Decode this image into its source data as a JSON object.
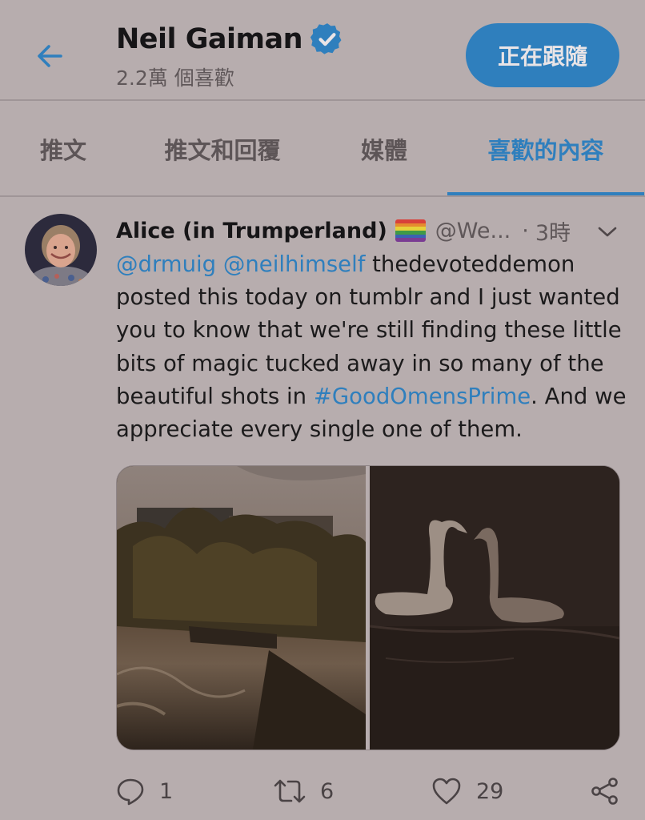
{
  "header": {
    "title": "Neil Gaiman",
    "likes_count": "2.2萬 個喜歡",
    "follow_label": "正在跟隨"
  },
  "tabs": [
    {
      "label": "推文"
    },
    {
      "label": "推文和回覆"
    },
    {
      "label": "媒體"
    },
    {
      "label": "喜歡的內容"
    }
  ],
  "active_tab": "喜歡的內容",
  "tweet": {
    "author": "Alice (in Trumperland)",
    "handle": "@We...",
    "separator": "·",
    "time": "3時",
    "mention1": "@drmuig",
    "mention2": "@neilhimself",
    "text_before_hashtag": " thedevoteddemon posted this today on tumblr and I just wanted you to know that we're still finding these little bits of magic tucked away in so many of the beautiful shots in ",
    "hashtag": "#GoodOmensPrime",
    "text_after_hashtag": ".  And we appreciate every single one of them.",
    "reply_count": "1",
    "retweet_count": "6",
    "like_count": "29"
  },
  "icons": {
    "back": "arrow-left-icon",
    "verified": "verified-badge-icon",
    "caret": "chevron-down-icon",
    "reply": "reply-icon",
    "retweet": "retweet-icon",
    "like": "heart-icon",
    "share": "share-icon"
  },
  "colors": {
    "background": "#b7adae",
    "accent": "#2f7fbd",
    "text": "#1c1b1c",
    "muted": "#5f5759"
  }
}
